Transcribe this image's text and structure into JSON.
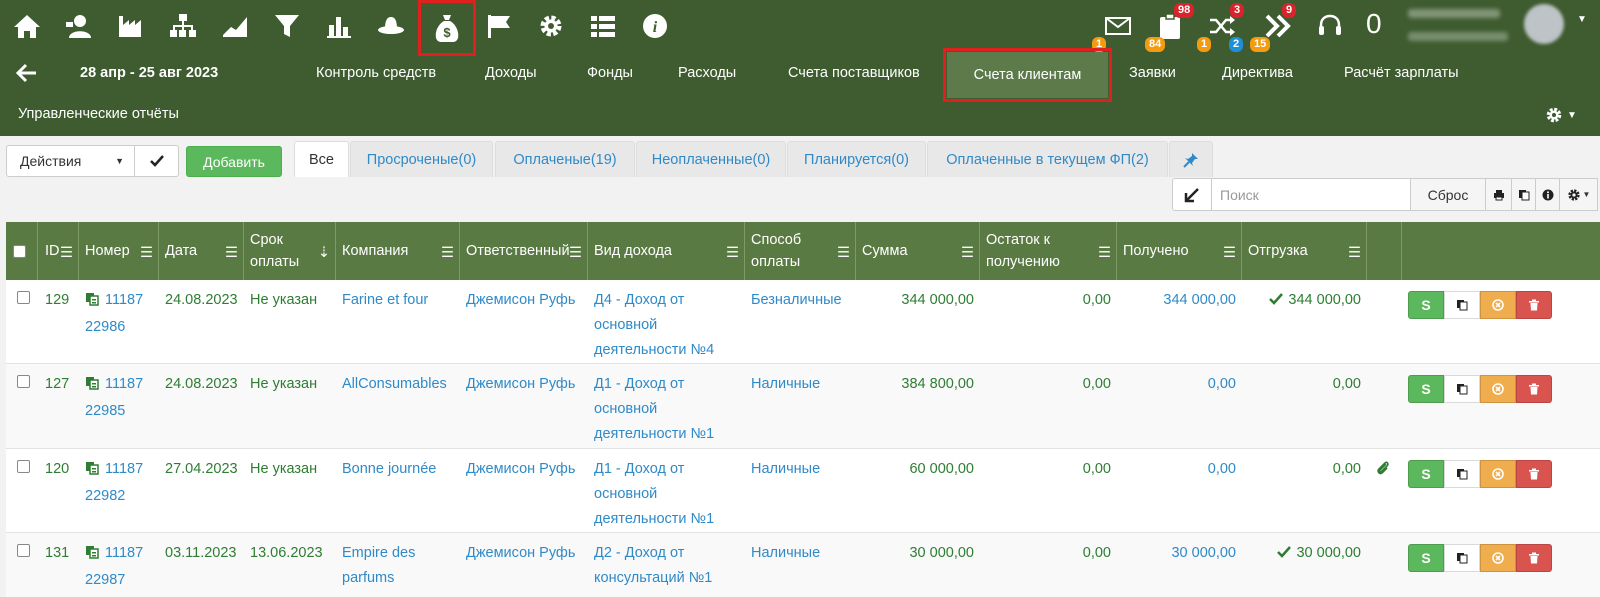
{
  "header": {
    "notification_badges": {
      "mail": "1",
      "tasks_top": "98",
      "tasks_bottom": "84",
      "shuffle_top": "3",
      "shuffle_bottom_orange": "1",
      "shuffle_bottom_blue": "2",
      "next_top": "9",
      "next_bottom": "15"
    },
    "counter": "0",
    "date_range": "28 апр - 25 авг 2023",
    "nav": [
      "Контроль средств",
      "Доходы",
      "Фонды",
      "Расходы",
      "Счета поставщиков",
      "Счета клиентам",
      "Заявки",
      "Директива",
      "Расчёт зарплаты"
    ],
    "reports": "Управленческие отчёты"
  },
  "toolbar": {
    "actions_label": "Действия",
    "add_label": "Добавить",
    "tabs": [
      "Все",
      "Просроченые(0)",
      "Оплаченые(19)",
      "Неоплаченные(0)",
      "Планируется(0)",
      "Оплаченные в текущем ФП(2)"
    ],
    "search_placeholder": "Поиск",
    "reset_label": "Сброс"
  },
  "table": {
    "headers": {
      "id": "ID",
      "number": "Номер",
      "date": "Дата",
      "due_1": "Срок",
      "due_2": "оплаты",
      "company": "Компания",
      "responsible": "Ответственный",
      "income_type": "Вид дохода",
      "pay_1": "Способ",
      "pay_2": "оплаты",
      "sum": "Сумма",
      "rem_1": "Остаток к",
      "rem_2": "получению",
      "received": "Получено",
      "shipment": "Отгрузка"
    },
    "rows": [
      {
        "id": "129",
        "num_1": "11187",
        "num_2": "22986",
        "date": "24.08.2023",
        "due": "Не указан",
        "company_1": "Farine et four",
        "company_2": "",
        "responsible": "Джемисон Руфь",
        "income_1": "Д4 - Доход от",
        "income_2": "основной",
        "income_3": "деятельности №4",
        "pay": "Безналичные",
        "sum": "344 000,00",
        "remaining": "0,00",
        "received": "344 000,00",
        "shipment": "344 000,00",
        "pay_btn": "S"
      },
      {
        "id": "127",
        "num_1": "11187",
        "num_2": "22985",
        "date": "24.08.2023",
        "due": "Не указан",
        "company_1": "AllConsumables",
        "company_2": "",
        "responsible": "Джемисон Руфь",
        "income_1": "Д1 - Доход от",
        "income_2": "основной",
        "income_3": "деятельности №1",
        "pay": "Наличные",
        "sum": "384 800,00",
        "remaining": "0,00",
        "received": "0,00",
        "shipment": "0,00",
        "pay_btn": "S"
      },
      {
        "id": "120",
        "num_1": "11187",
        "num_2": "22982",
        "date": "27.04.2023",
        "due": "Не указан",
        "company_1": "Bonne journée",
        "company_2": "",
        "responsible": "Джемисон Руфь",
        "income_1": "Д1 - Доход от",
        "income_2": "основной",
        "income_3": "деятельности №1",
        "pay": "Наличные",
        "sum": "60 000,00",
        "remaining": "0,00",
        "received": "0,00",
        "shipment": "0,00",
        "pay_btn": "S"
      },
      {
        "id": "131",
        "num_1": "11187",
        "num_2": "22987",
        "date": "03.11.2023",
        "due": "13.06.2023",
        "company_1": "Empire des",
        "company_2": "parfums",
        "responsible": "Джемисон Руфь",
        "income_1": "Д2 - Доход от",
        "income_2": "консультаций №1",
        "income_3": "",
        "pay": "Наличные",
        "sum": "30 000,00",
        "remaining": "0,00",
        "received": "30 000,00",
        "shipment": "30 000,00",
        "pay_btn": "S"
      }
    ]
  },
  "colors": {
    "header_bg": "#3e5c2f",
    "table_header_bg": "#5a7a44",
    "active_nav": "#5d7b4a",
    "highlight": "#e01f1f",
    "link": "#2f8ac8",
    "green_text": "#2e7d32",
    "success": "#5cb85c",
    "warning": "#f0ad4e",
    "danger": "#d9534f"
  },
  "icons": {
    "top": [
      "home-icon",
      "user-card-icon",
      "factory-icon",
      "org-chart-icon",
      "area-chart-icon",
      "funnel-icon",
      "bar-chart-icon",
      "hat-icon",
      "money-bag-icon",
      "flag-icon",
      "gear-icon",
      "list-icon",
      "info-icon"
    ],
    "right": [
      "mail-icon",
      "clipboard-icon",
      "shuffle-icon",
      "double-chevron-icon",
      "headset-icon"
    ]
  }
}
